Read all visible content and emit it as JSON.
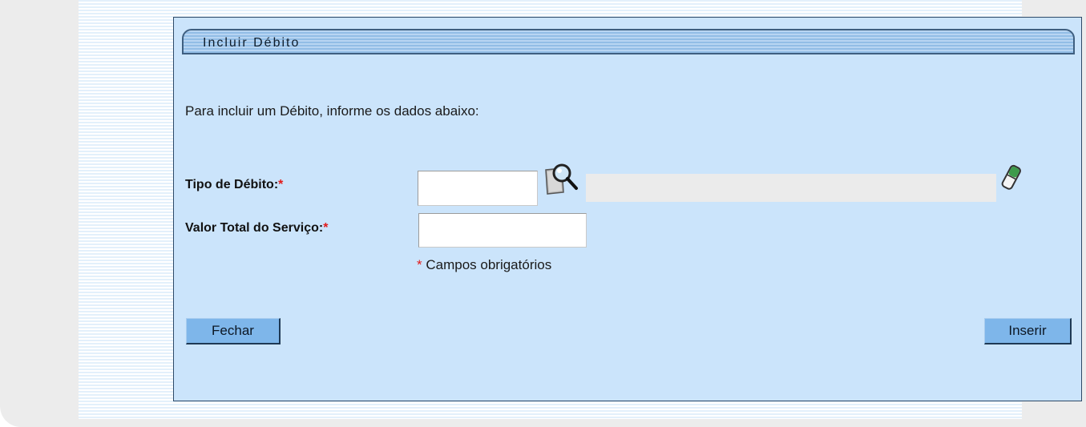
{
  "panel": {
    "title": "Incluir Débito",
    "intro": "Para incluir um Débito, informe os dados abaixo:"
  },
  "form": {
    "tipo_debito": {
      "label": "Tipo de Débito:",
      "required_mark": "*",
      "code_value": "",
      "description_value": "",
      "search_icon": "magnifier-document-icon",
      "clear_icon": "eraser-icon"
    },
    "valor_total": {
      "label": "Valor Total do Serviço:",
      "required_mark": "*",
      "value": ""
    },
    "required_note_mark": "*",
    "required_note": "Campos obrigatórios"
  },
  "buttons": {
    "close": "Fechar",
    "insert": "Inserir"
  },
  "colors": {
    "panel_bg": "#cbe4fb",
    "button_bg": "#7eb6ea",
    "required": "#e21b1b"
  }
}
